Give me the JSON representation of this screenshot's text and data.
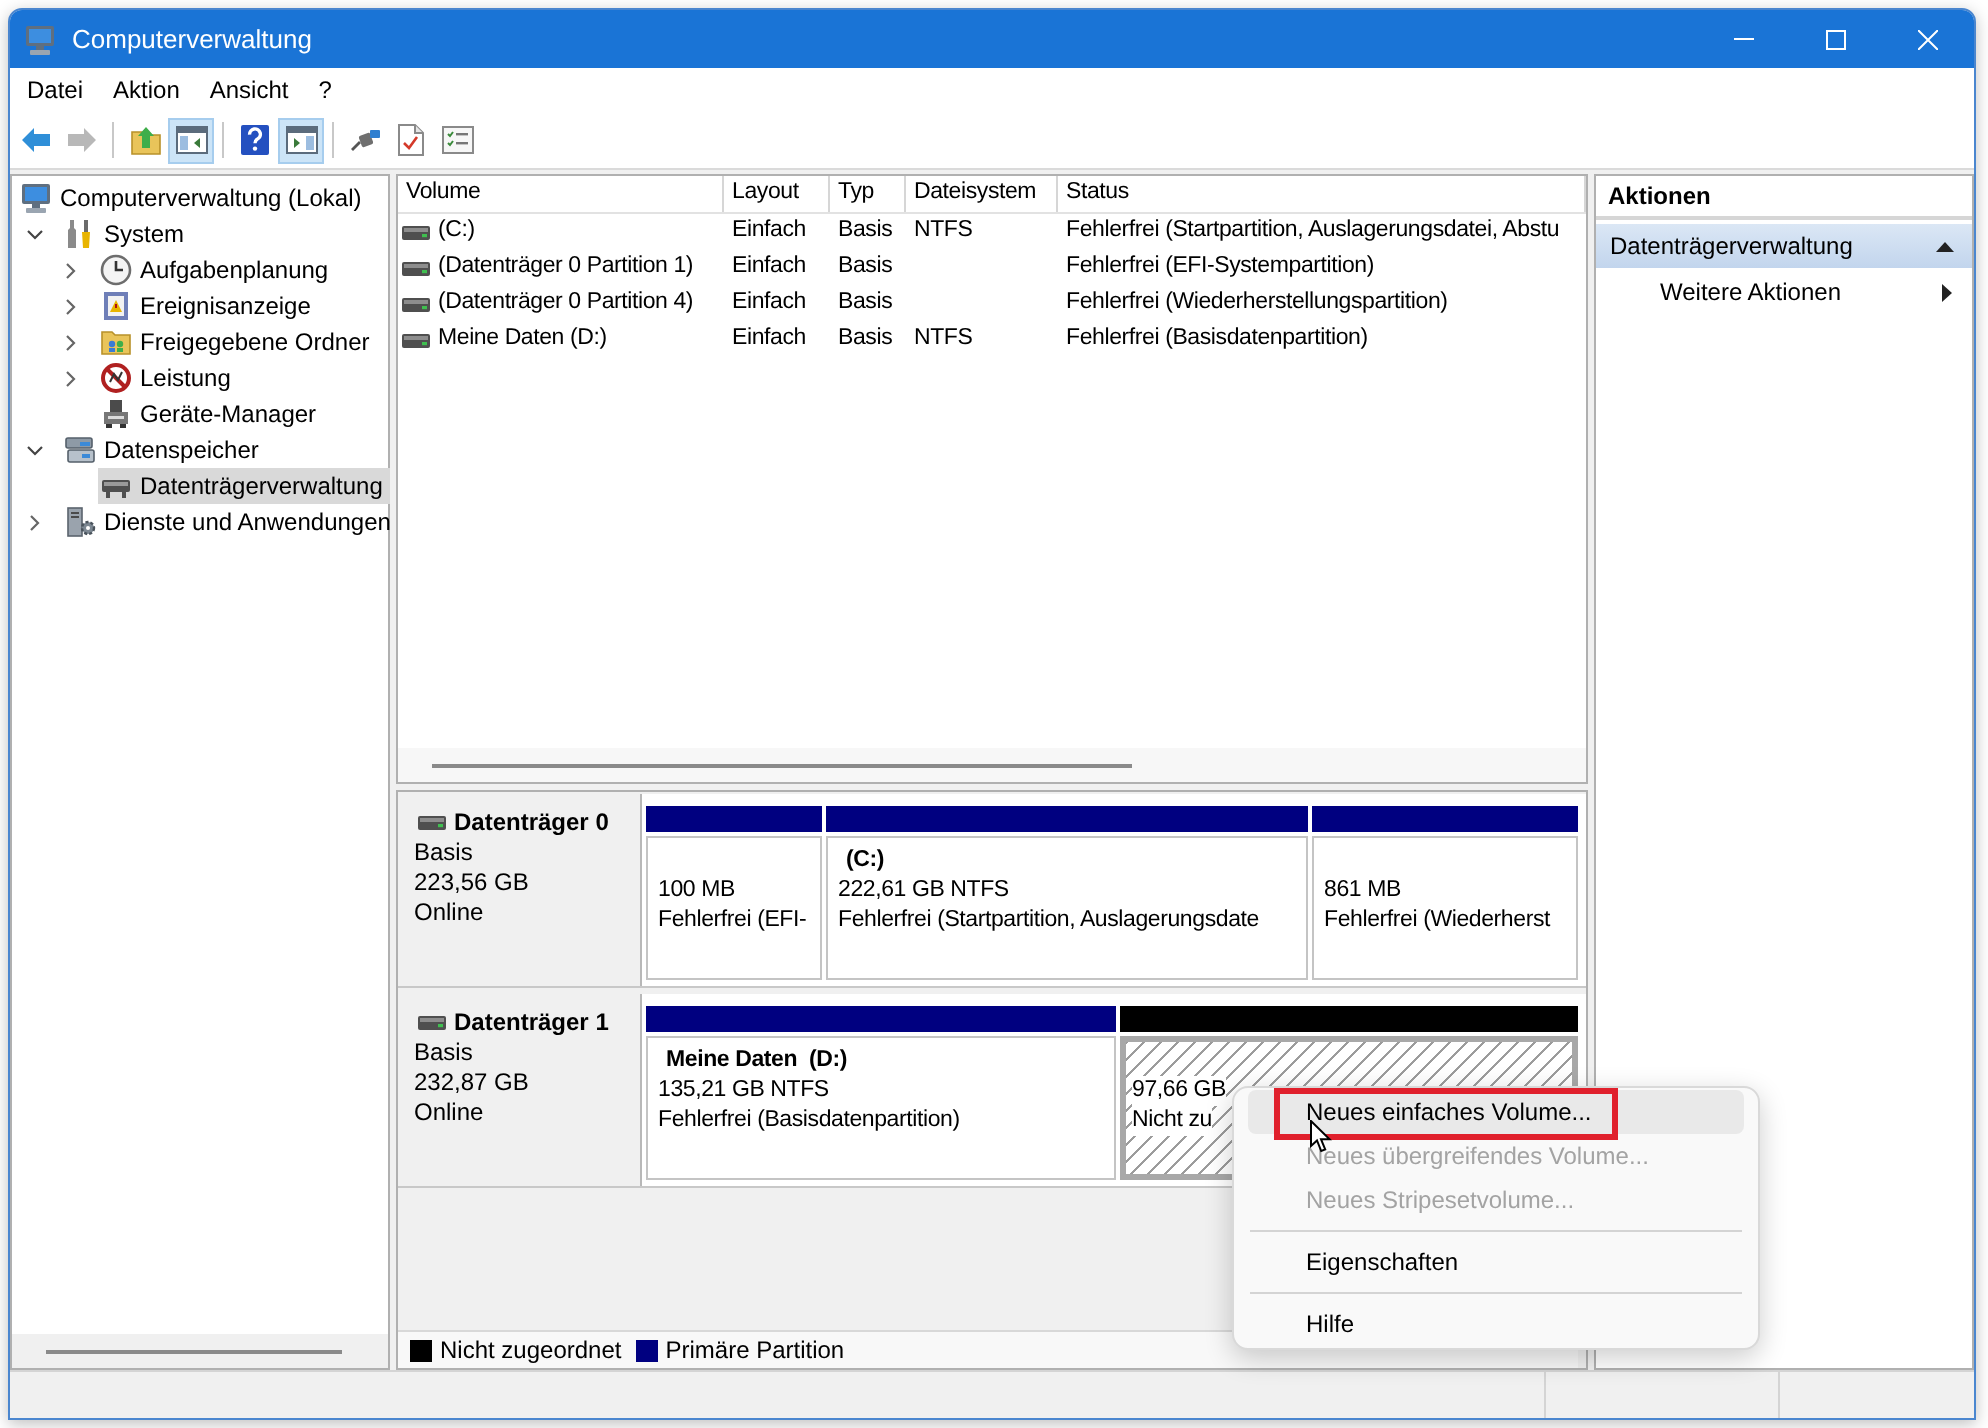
{
  "window": {
    "title": "Computerverwaltung"
  },
  "menu": [
    "Datei",
    "Aktion",
    "Ansicht",
    "?"
  ],
  "toolbar": [
    {
      "kind": "back",
      "disabled": false
    },
    {
      "kind": "forward",
      "disabled": true
    },
    {
      "kind": "separator"
    },
    {
      "kind": "up"
    },
    {
      "kind": "console-tree",
      "pressed": true
    },
    {
      "kind": "separator"
    },
    {
      "kind": "help"
    },
    {
      "kind": "action-pane",
      "pressed": true
    },
    {
      "kind": "separator"
    },
    {
      "kind": "connect"
    },
    {
      "kind": "checklist"
    },
    {
      "kind": "properties"
    }
  ],
  "tree": {
    "label": "Computerverwaltung (Lokal)",
    "kind": "computer",
    "selected": false,
    "children": [
      {
        "label": "System",
        "kind": "tools",
        "expanded": true,
        "selected": false,
        "children": [
          {
            "label": "Aufgabenplanung",
            "kind": "clock",
            "expanded": false,
            "selected": false
          },
          {
            "label": "Ereignisanzeige",
            "kind": "event-log",
            "expanded": false,
            "selected": false
          },
          {
            "label": "Freigegebene Ordner",
            "kind": "shared-folder",
            "expanded": false,
            "selected": false
          },
          {
            "label": "Leistung",
            "kind": "performance",
            "expanded": false,
            "selected": false
          },
          {
            "label": "Geräte-Manager",
            "kind": "device",
            "selected": false
          }
        ]
      },
      {
        "label": "Datenspeicher",
        "kind": "storage",
        "expanded": true,
        "selected": false,
        "children": [
          {
            "label": "Datenträgerverwaltung",
            "kind": "disk",
            "selected": true
          }
        ]
      },
      {
        "label": "Dienste und Anwendungen",
        "kind": "services",
        "expanded": false,
        "selected": false
      }
    ]
  },
  "volumes": {
    "columns": [
      "Volume",
      "Layout",
      "Typ",
      "Dateisystem",
      "Status"
    ],
    "rows": [
      {
        "volume": "(C:)",
        "layout": "Einfach",
        "type": "Basis",
        "file_system": "NTFS",
        "status": "Fehlerfrei (Startpartition, Auslagerungsdatei, Abstu"
      },
      {
        "volume": "(Datenträger 0 Partition 1)",
        "layout": "Einfach",
        "type": "Basis",
        "status": "Fehlerfrei (EFI-Systempartition)"
      },
      {
        "volume": "(Datenträger 0 Partition 4)",
        "layout": "Einfach",
        "type": "Basis",
        "status": "Fehlerfrei (Wiederherstellungspartition)"
      },
      {
        "volume": "Meine Daten (D:)",
        "layout": "Einfach",
        "type": "Basis",
        "file_system": "NTFS",
        "status": "Fehlerfrei (Basisdatenpartition)"
      }
    ]
  },
  "disks": [
    {
      "name": "Datenträger 0",
      "type": "Basis",
      "size": "223,56 GB",
      "status": "Online",
      "partitions": [
        {
          "color": "#000080",
          "selected": false,
          "size": "100 MB",
          "status": "Fehlerfrei (EFI-"
        },
        {
          "color": "#000080",
          "selected": false,
          "name": "(C:)",
          "size": "222,61 GB NTFS",
          "status": "Fehlerfrei (Startpartition, Auslagerungsdate"
        },
        {
          "color": "#000080",
          "selected": false,
          "size": "861 MB",
          "status": "Fehlerfrei (Wiederherst"
        }
      ]
    },
    {
      "name": "Datenträger 1",
      "type": "Basis",
      "size": "232,87 GB",
      "status": "Online",
      "partitions": [
        {
          "color": "#000080",
          "selected": false,
          "name": "Meine Daten  (D:)",
          "size": "135,21 GB NTFS",
          "status": "Fehlerfrei (Basisdatenpartition)"
        },
        {
          "color": "#000000",
          "selected": true,
          "size": "97,66 GB",
          "status": "Nicht zu"
        }
      ]
    }
  ],
  "legend": [
    {
      "label": "Nicht zugeordnet",
      "color": "#000000"
    },
    {
      "label": "Primäre Partition",
      "color": "#000080"
    }
  ],
  "actions": {
    "title": "Aktionen",
    "sections": [
      {
        "title": "Datenträgerverwaltung",
        "expanded": true,
        "items": [
          {
            "label": "Weitere Aktionen",
            "submenu": true
          }
        ]
      }
    ]
  },
  "context_menu": [
    {
      "kind": "item",
      "label": "Neues einfaches Volume...",
      "disabled": false,
      "selected": true,
      "marked": true
    },
    {
      "kind": "item",
      "label": "Neues übergreifendes Volume...",
      "disabled": true,
      "selected": false,
      "marked": false
    },
    {
      "kind": "item",
      "label": "Neues Stripesetvolume...",
      "disabled": true,
      "selected": false,
      "marked": false
    },
    {
      "kind": "separator"
    },
    {
      "kind": "item",
      "label": "Eigenschaften",
      "disabled": false,
      "selected": false,
      "marked": false
    },
    {
      "kind": "separator"
    },
    {
      "kind": "item",
      "label": "Hilfe",
      "disabled": false,
      "selected": false,
      "marked": false
    }
  ]
}
